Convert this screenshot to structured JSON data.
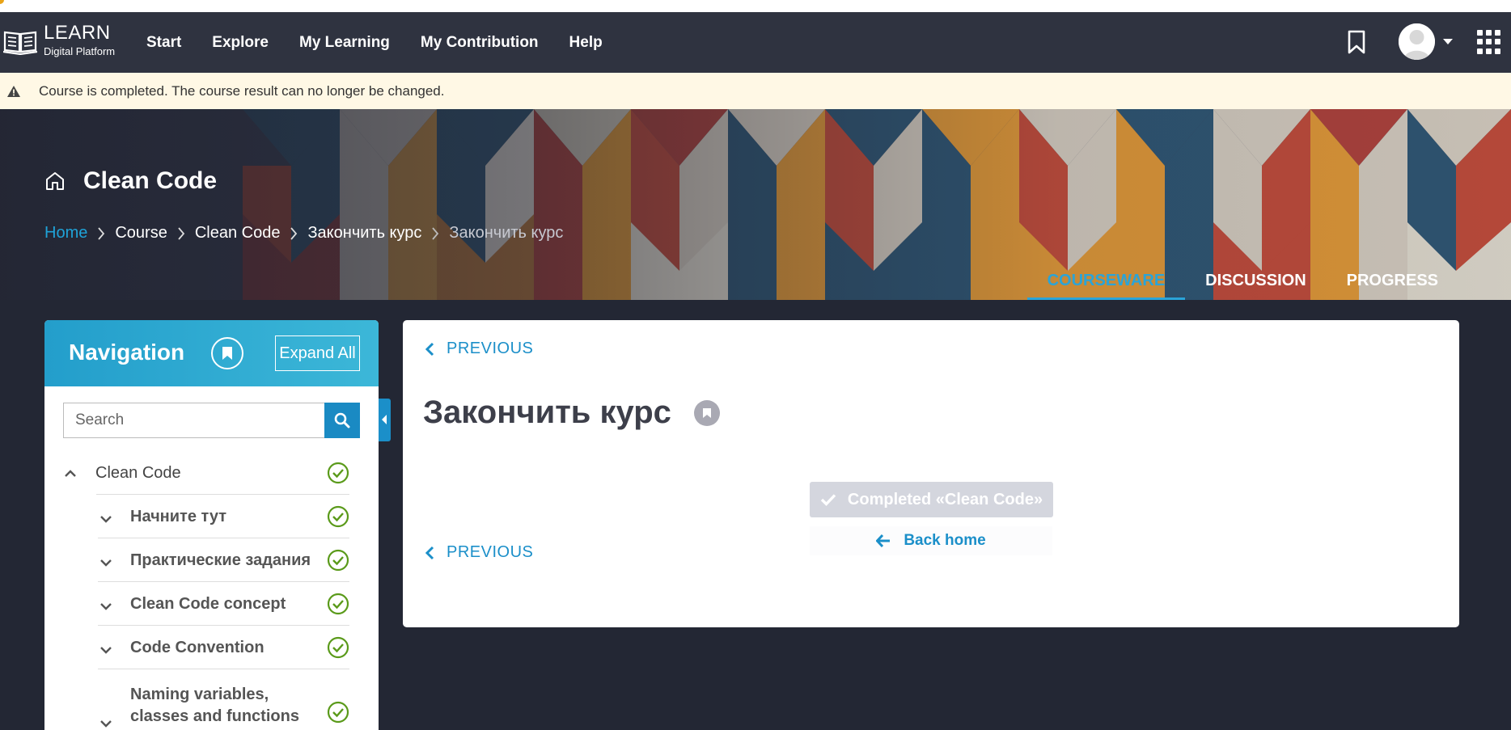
{
  "brand": {
    "name": "LEARN",
    "subtitle": "Digital Platform"
  },
  "nav": {
    "items": [
      "Start",
      "Explore",
      "My Learning",
      "My Contribution",
      "Help"
    ]
  },
  "alert": {
    "text": "Course is completed. The course result can no longer be changed."
  },
  "course": {
    "title": "Clean Code",
    "breadcrumbs": [
      "Home",
      "Course",
      "Clean Code",
      "Закончить курс",
      "Закончить курс"
    ]
  },
  "tabs": [
    "COURSEWARE",
    "DISCUSSION",
    "PROGRESS"
  ],
  "active_tab": "COURSEWARE",
  "sidebar": {
    "title": "Navigation",
    "expand_label": "Expand All",
    "search_placeholder": "Search",
    "tree": [
      {
        "label": "Clean Code",
        "completed": true,
        "expanded": true
      },
      {
        "label": "Начните тут",
        "completed": true
      },
      {
        "label": "Практические задания",
        "completed": true
      },
      {
        "label": "Clean Code concept",
        "completed": true
      },
      {
        "label": "Code Convention",
        "completed": true
      },
      {
        "label": "Naming variables, classes and functions",
        "completed": true
      }
    ]
  },
  "unit": {
    "previous_label": "PREVIOUS",
    "title": "Закончить курс",
    "completed_label": "Completed  «Clean Code»",
    "back_home_label": "Back home"
  },
  "colors": {
    "accent": "#1b8fc9",
    "navbar": "#2f3340",
    "page_bg": "#232734",
    "alert_bg": "#fff8e5",
    "check": "#5a9a1a"
  }
}
